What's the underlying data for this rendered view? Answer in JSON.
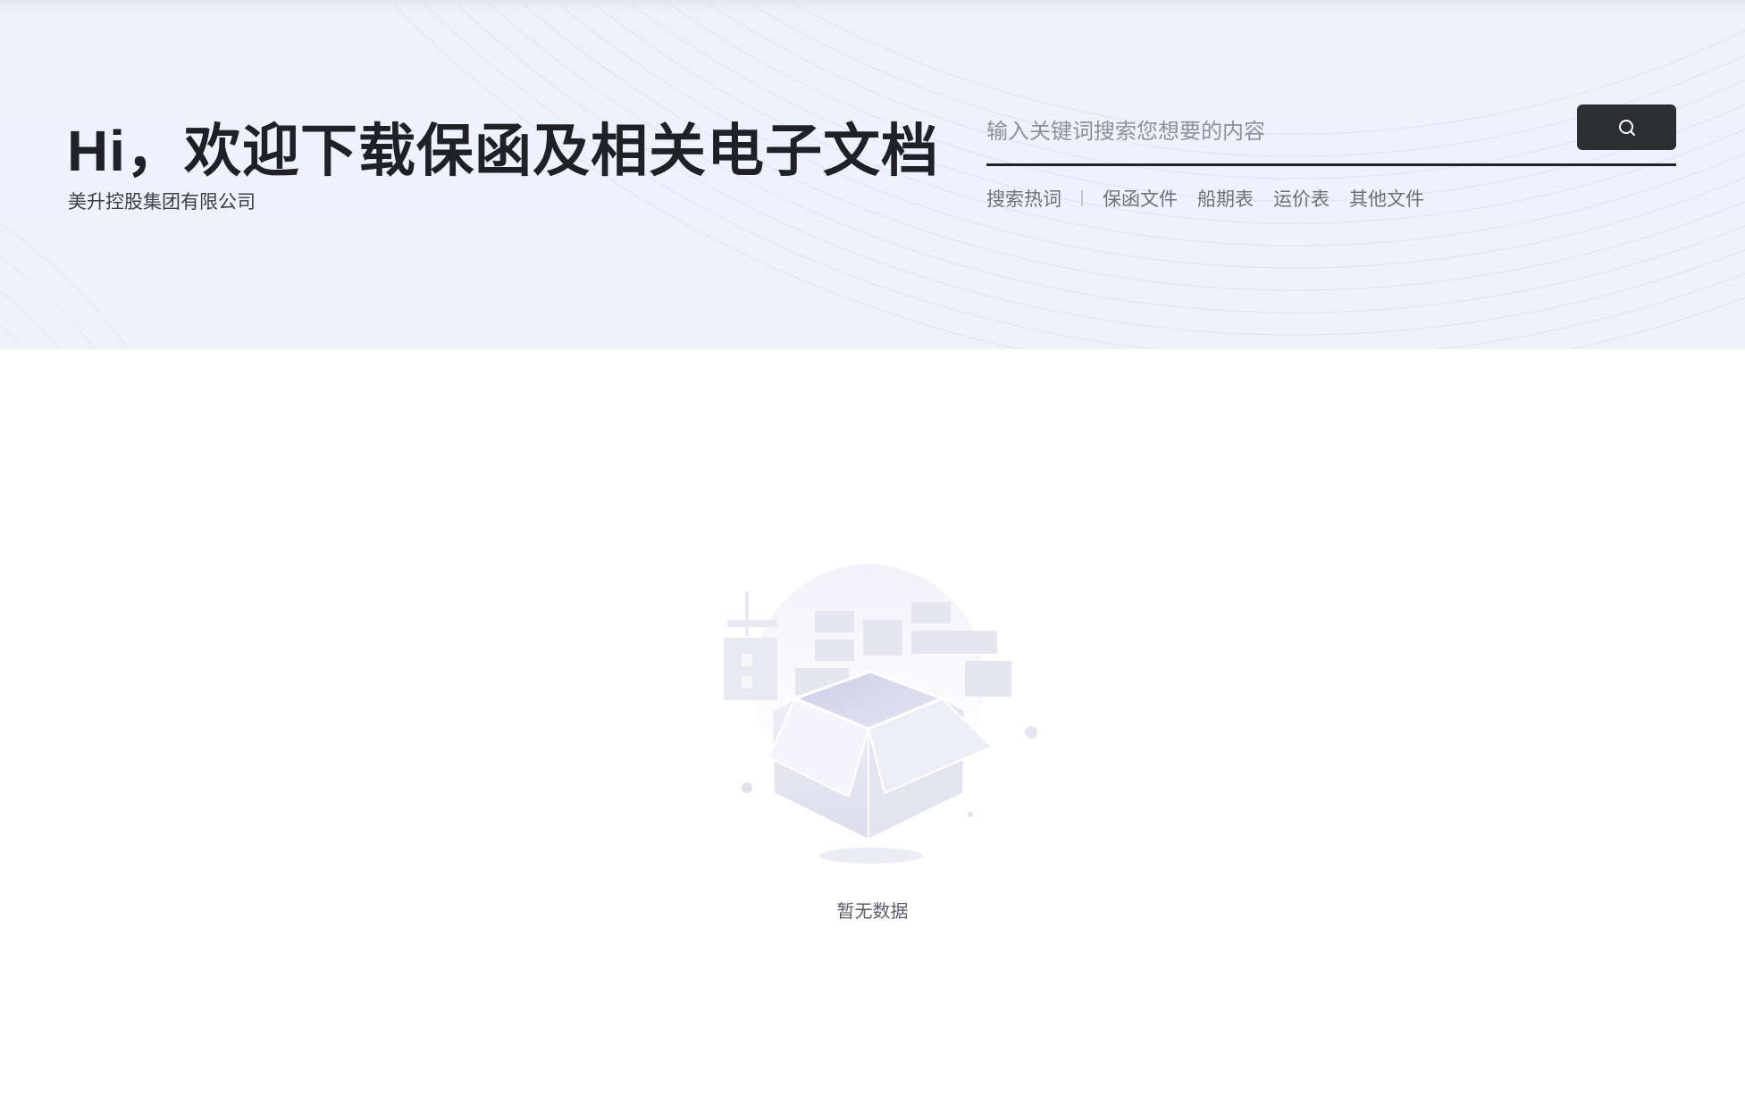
{
  "header": {
    "title": "Hi，欢迎下载保函及相关电子文档",
    "company": "美升控股集团有限公司"
  },
  "search": {
    "placeholder": "输入关键词搜索您想要的内容",
    "value": "",
    "button_icon": "search-icon"
  },
  "hot_search": {
    "label": "搜索热词",
    "items": [
      "保函文件",
      "船期表",
      "运价表",
      "其他文件"
    ]
  },
  "empty_state": {
    "icon": "empty-box-icon",
    "text": "暂无数据"
  },
  "colors": {
    "banner_bg": "#edf2fe",
    "title": "#1f2127",
    "search_button": "#2c2e31",
    "muted_text": "#6d7078"
  }
}
